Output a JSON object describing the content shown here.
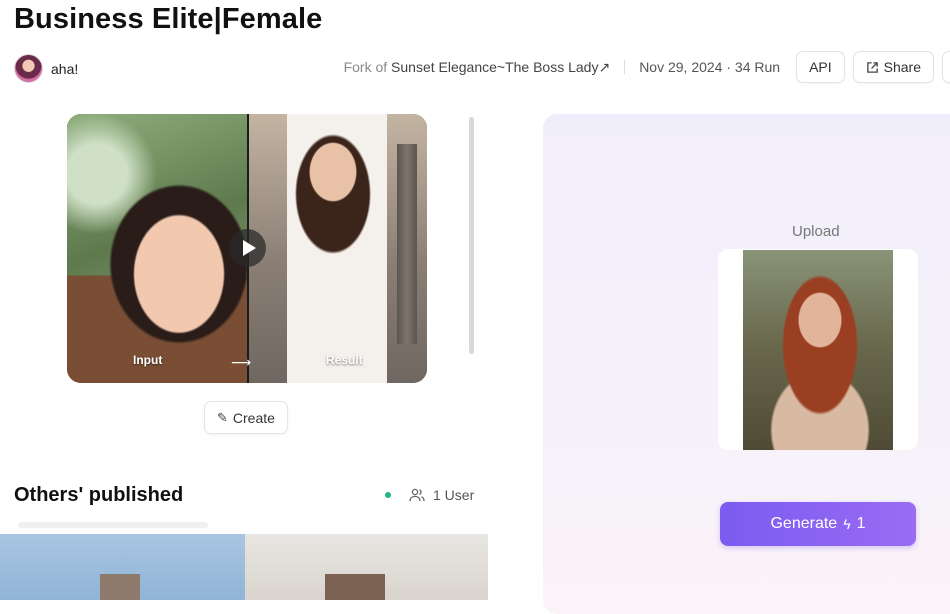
{
  "page": {
    "title": "Business Elite|Female"
  },
  "author": {
    "name": "aha!"
  },
  "meta": {
    "fork_prefix": "Fork of",
    "fork_source": "Sunset Elegance~The Boss Lady",
    "fork_arrow": "↗",
    "date_runs": "Nov 29, 2024 · 34 Run"
  },
  "actions": {
    "api_label": "API",
    "share_label": "Share"
  },
  "preview": {
    "input_label": "Input",
    "result_label": "Result",
    "arrow": "⟶"
  },
  "create": {
    "label": "Create"
  },
  "others": {
    "title": "Others' published",
    "users": "1 User"
  },
  "upload": {
    "label": "Upload"
  },
  "generate": {
    "label": "Generate",
    "cost": "1"
  },
  "icons": {
    "share": "share-icon",
    "wand": "magic-wand-icon",
    "play": "play-icon",
    "users": "users-icon",
    "bolt": "lightning-icon"
  },
  "colors": {
    "accent": "#8a63f2",
    "online": "#1fb57f"
  }
}
